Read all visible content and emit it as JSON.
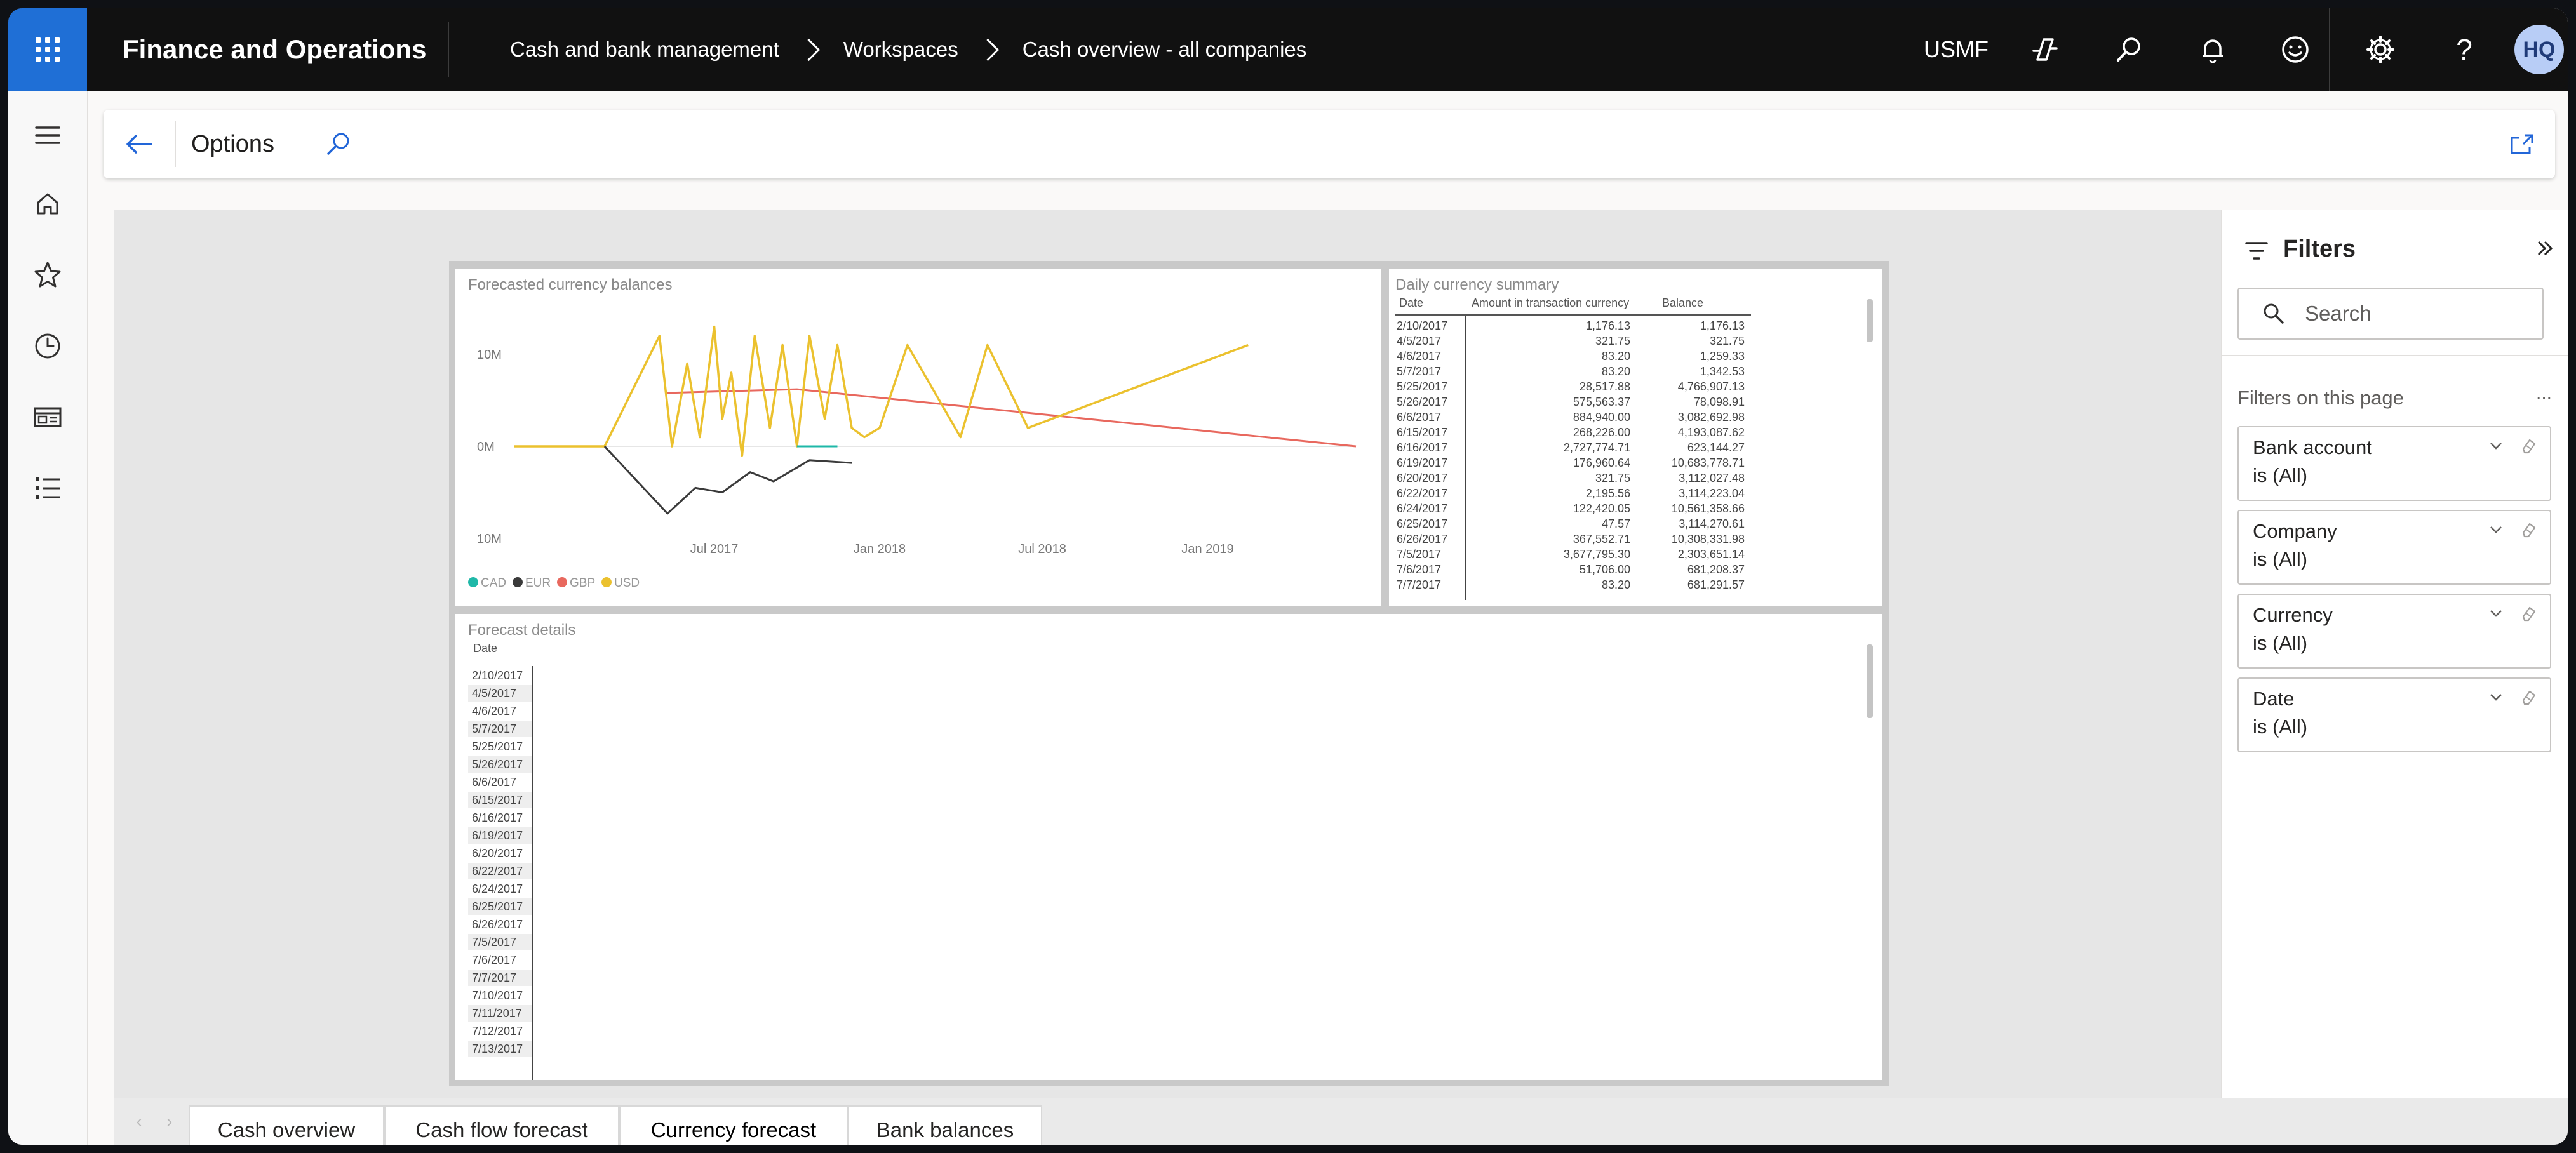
{
  "app": {
    "title": "Finance and Operations",
    "breadcrumb": [
      "Cash and bank management",
      "Workspaces",
      "Cash overview - all companies"
    ],
    "company": "USMF",
    "user_initials": "HQ"
  },
  "topbar_icons": [
    "copilot-icon",
    "search-icon",
    "bell-icon",
    "smiley-icon",
    "gear-icon",
    "help-icon"
  ],
  "left_nav": [
    "hamburger-icon",
    "home-icon",
    "star-icon",
    "clock-icon",
    "workspace-icon",
    "list-icon"
  ],
  "action_pane": {
    "title": "Options"
  },
  "report": {
    "forecast_chart": {
      "title": "Forecasted currency balances"
    },
    "daily_summary": {
      "title": "Daily currency summary",
      "columns": [
        "Date",
        "Amount in transaction currency",
        "Balance"
      ],
      "rows": [
        [
          "2/10/2017",
          "1,176.13",
          "1,176.13"
        ],
        [
          "4/5/2017",
          "321.75",
          "321.75"
        ],
        [
          "4/6/2017",
          "83.20",
          "1,259.33"
        ],
        [
          "5/7/2017",
          "83.20",
          "1,342.53"
        ],
        [
          "5/25/2017",
          "28,517.88",
          "4,766,907.13"
        ],
        [
          "5/26/2017",
          "575,563.37",
          "78,098.91"
        ],
        [
          "6/6/2017",
          "884,940.00",
          "3,082,692.98"
        ],
        [
          "6/15/2017",
          "268,226.00",
          "4,193,087.62"
        ],
        [
          "6/16/2017",
          "2,727,774.71",
          "623,144.27"
        ],
        [
          "6/19/2017",
          "176,960.64",
          "10,683,778.71"
        ],
        [
          "6/20/2017",
          "321.75",
          "3,112,027.48"
        ],
        [
          "6/22/2017",
          "2,195.56",
          "3,114,223.04"
        ],
        [
          "6/24/2017",
          "122,420.05",
          "10,561,358.66"
        ],
        [
          "6/25/2017",
          "47.57",
          "3,114,270.61"
        ],
        [
          "6/26/2017",
          "367,552.71",
          "10,308,331.98"
        ],
        [
          "7/5/2017",
          "3,677,795.30",
          "2,303,651.14"
        ],
        [
          "7/6/2017",
          "51,706.00",
          "681,208.37"
        ],
        [
          "7/7/2017",
          "83.20",
          "681,291.57"
        ]
      ]
    },
    "forecast_details": {
      "title": "Forecast details",
      "column": "Date",
      "dates": [
        "2/10/2017",
        "4/5/2017",
        "4/6/2017",
        "5/7/2017",
        "5/25/2017",
        "5/26/2017",
        "6/6/2017",
        "6/15/2017",
        "6/16/2017",
        "6/19/2017",
        "6/20/2017",
        "6/22/2017",
        "6/24/2017",
        "6/25/2017",
        "6/26/2017",
        "7/5/2017",
        "7/6/2017",
        "7/7/2017",
        "7/10/2017",
        "7/11/2017",
        "7/12/2017",
        "7/13/2017"
      ]
    }
  },
  "chart_data": {
    "type": "line",
    "title": "Forecasted currency balances",
    "y_tick_labels": [
      "10M",
      "0M",
      "10M"
    ],
    "x_tick_labels": [
      "Jul 2017",
      "Jan 2018",
      "Jul 2018",
      "Jan 2019"
    ],
    "ylim": [
      -10,
      10
    ],
    "y_unit": "M",
    "legend_position": "bottom-left",
    "series": [
      {
        "name": "CAD",
        "color": "#1fb8a8",
        "x": [
          "2017-10-01",
          "2017-11-15"
        ],
        "y": [
          0,
          0
        ]
      },
      {
        "name": "EUR",
        "color": "#3a3a3a",
        "x": [
          "2017-03-01",
          "2017-05-10",
          "2017-06-10",
          "2017-07-10",
          "2017-08-10",
          "2017-09-05",
          "2017-10-15",
          "2017-12-01"
        ],
        "y": [
          0,
          -7.3,
          -4.5,
          -5.0,
          -2.8,
          -3.8,
          -1.5,
          -1.8
        ]
      },
      {
        "name": "GBP",
        "color": "#e8685e",
        "x": [
          "2017-05-10",
          "2017-10-01",
          "2019-06-15"
        ],
        "y": [
          5.8,
          6.2,
          0
        ]
      },
      {
        "name": "USD",
        "color": "#ebc12e",
        "x": [
          "2016-11-20",
          "2017-03-01",
          "2017-05-01",
          "2017-05-15",
          "2017-06-01",
          "2017-06-15",
          "2017-07-01",
          "2017-07-10",
          "2017-07-20",
          "2017-08-01",
          "2017-08-15",
          "2017-09-01",
          "2017-09-15",
          "2017-10-01",
          "2017-10-15",
          "2017-11-01",
          "2017-11-15",
          "2017-12-01",
          "2017-12-15",
          "2018-01-01",
          "2018-02-01",
          "2018-04-01",
          "2018-05-01",
          "2018-06-15",
          "2019-02-15"
        ],
        "y": [
          0,
          0,
          12,
          0,
          9,
          1,
          13,
          3,
          8,
          -1,
          12,
          2,
          11,
          0,
          12,
          3,
          11,
          2,
          1,
          2,
          11,
          1,
          11,
          2,
          11
        ]
      }
    ]
  },
  "filters": {
    "title": "Filters",
    "search_placeholder": "Search",
    "section": "Filters on this page",
    "more": "...",
    "cards": [
      {
        "name": "Bank account",
        "value": "is (All)"
      },
      {
        "name": "Company",
        "value": "is (All)"
      },
      {
        "name": "Currency",
        "value": "is (All)"
      },
      {
        "name": "Date",
        "value": "is (All)"
      }
    ]
  },
  "tabs": [
    {
      "label": "Cash overview",
      "active": false
    },
    {
      "label": "Cash flow forecast",
      "active": false
    },
    {
      "label": "Currency forecast",
      "active": true
    },
    {
      "label": "Bank balances",
      "active": false
    }
  ]
}
